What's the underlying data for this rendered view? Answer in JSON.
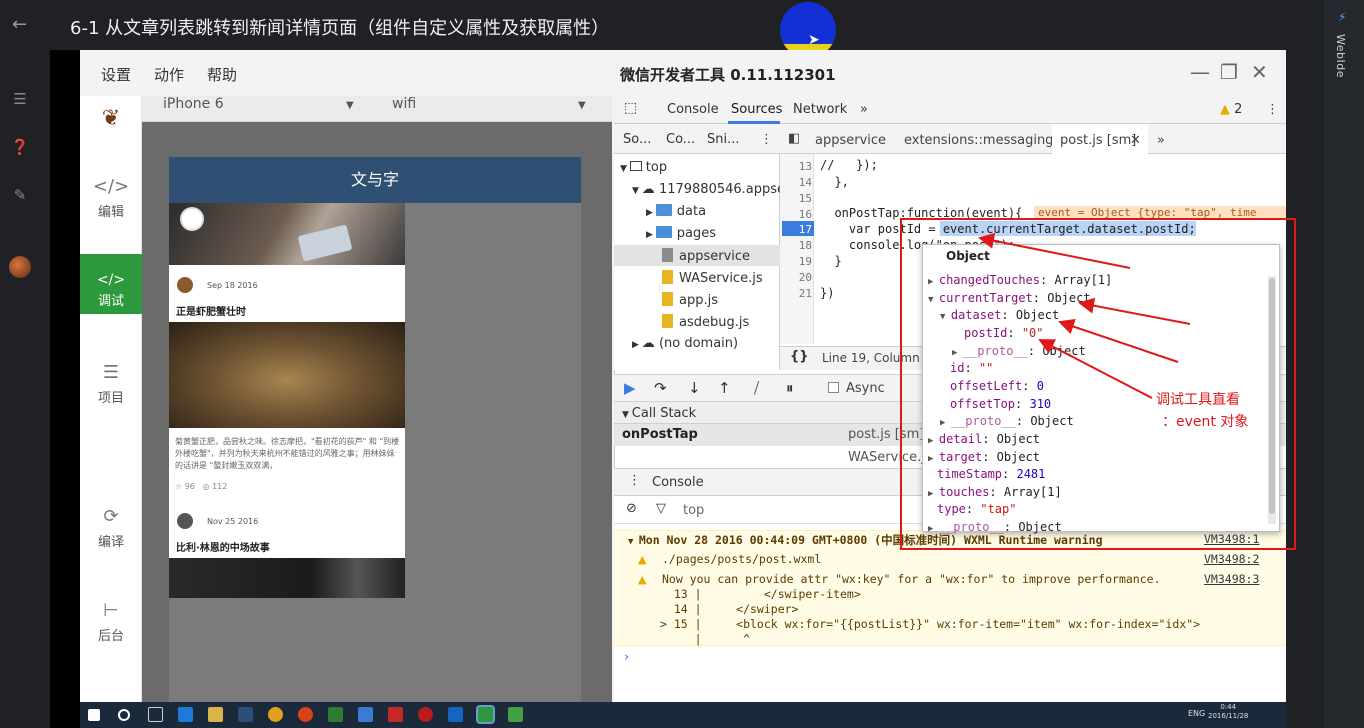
{
  "lesson": {
    "title": "6-1 从文章列表跳转到新闻详情页面（组件自定义属性及获取属性）"
  },
  "side_label": "WebIde",
  "app": {
    "menu": [
      "设置",
      "动作",
      "帮助"
    ],
    "title": "微信开发者工具 0.11.112301",
    "window_controls": [
      "—",
      "❐",
      "✕"
    ]
  },
  "left_nav": [
    {
      "label": "编辑",
      "icon": "code-icon"
    },
    {
      "label": "调试",
      "icon": "debug-icon"
    },
    {
      "label": "项目",
      "icon": "list-icon"
    },
    {
      "label": "编译",
      "icon": "compile-icon"
    },
    {
      "label": "后台",
      "icon": "backend-icon"
    }
  ],
  "simulator": {
    "device": "iPhone 6",
    "network": "wifi",
    "page_title": "文与字",
    "posts": [
      {
        "date": "Sep 18 2016",
        "title": "正是虾肥蟹壮时",
        "excerpt": "菊黄蟹正肥，品尝秋之味。徐志摩把，\"看初花的荻芦\" 和 \"到楼外楼吃蟹\"，并列为秋天来杭州不能错过的风雅之事；用林妹妹的话讲是 \"螯封嫩玉双双满，",
        "likes": "96",
        "views": "112"
      },
      {
        "date": "Nov 25 2016",
        "title": "比利·林恩的中场故事"
      }
    ]
  },
  "devtools": {
    "tabs": [
      "Console",
      "Sources",
      "Network",
      "»"
    ],
    "warning_count": "2",
    "navigator_tabs": [
      "So...",
      "Co...",
      "Sni...",
      "⋮"
    ],
    "tree": [
      {
        "label": "top"
      },
      {
        "label": "1179880546.appser"
      },
      {
        "label": "data"
      },
      {
        "label": "pages"
      },
      {
        "label": "appservice"
      },
      {
        "label": "WAService.js"
      },
      {
        "label": "app.js"
      },
      {
        "label": "asdebug.js"
      },
      {
        "label": "(no domain)"
      }
    ],
    "editor_tabs": [
      "appservice",
      "extensions::messaging",
      "post.js [sm]",
      "»"
    ],
    "code": [
      {
        "n": "13",
        "text": "//   });"
      },
      {
        "n": "14",
        "text": "  },"
      },
      {
        "n": "15",
        "text": ""
      },
      {
        "n": "16",
        "text": "  onPostTap:function(event){"
      },
      {
        "n": "17",
        "text": "    var postId = event.currentTarget.dataset.postId;"
      },
      {
        "n": "18",
        "text": "    console.log(\"on post\");"
      },
      {
        "n": "19",
        "text": "  }"
      },
      {
        "n": "20",
        "text": ""
      },
      {
        "n": "21",
        "text": "})"
      }
    ],
    "inline_hint": "event = Object {type: \"tap\", time",
    "status": "Line 19, Column",
    "async_label": "Async",
    "callstack_title": "Call Stack",
    "callstack": [
      {
        "fn": "onPostTap",
        "loc": "post.js [sm]:17"
      },
      {
        "fn": "",
        "loc": "WAService.js"
      }
    ],
    "console_tab": "Console",
    "console_context": "top",
    "console_lines": [
      {
        "text": "Mon Nov 28 2016 00:44:09 GMT+0800 (中国标准时间) WXML Runtime warning",
        "link": "VM3498:1"
      },
      {
        "text": "./pages/posts/post.wxml",
        "link": "VM3498:2"
      },
      {
        "text": "Now you can provide attr \"wx:key\" for a \"wx:for\" to improve performance.",
        "link": "VM3498:3"
      },
      {
        "text": "  13 |         </swiper-item>",
        "link": ""
      },
      {
        "text": "  14 |     </swiper>",
        "link": ""
      },
      {
        "text": "> 15 |     <block wx:for=\"{{postList}}\" wx:for-item=\"item\" wx:for-index=\"idx\">",
        "link": ""
      },
      {
        "text": "     |      ^",
        "link": ""
      }
    ]
  },
  "popover": {
    "title": "Object",
    "rows": [
      {
        "key": "changedTouches",
        "value": "Array[1]",
        "kind": "obj"
      },
      {
        "key": "currentTarget",
        "value": "Object",
        "kind": "obj"
      },
      {
        "key": "dataset",
        "value": "Object",
        "kind": "obj"
      },
      {
        "key": "postId",
        "value": "\"0\"",
        "kind": "str"
      },
      {
        "key": "__proto__",
        "value": "Object",
        "kind": "obj"
      },
      {
        "key": "id",
        "value": "\"\"",
        "kind": "str"
      },
      {
        "key": "offsetLeft",
        "value": "0",
        "kind": "num"
      },
      {
        "key": "offsetTop",
        "value": "310",
        "kind": "num"
      },
      {
        "key": "__proto__",
        "value": "Object",
        "kind": "obj"
      },
      {
        "key": "detail",
        "value": "Object",
        "kind": "obj"
      },
      {
        "key": "target",
        "value": "Object",
        "kind": "obj"
      },
      {
        "key": "timeStamp",
        "value": "2481",
        "kind": "num"
      },
      {
        "key": "touches",
        "value": "Array[1]",
        "kind": "obj"
      },
      {
        "key": "type",
        "value": "\"tap\"",
        "kind": "str"
      },
      {
        "key": "__proto__",
        "value": "Object",
        "kind": "obj"
      }
    ]
  },
  "annotation": {
    "line1": "调试工具直看",
    "line2": "：event 对象",
    "color": "#e01818"
  },
  "taskbar": {
    "lang": "ENG",
    "time": "0:44",
    "date": "2016/11/28"
  }
}
